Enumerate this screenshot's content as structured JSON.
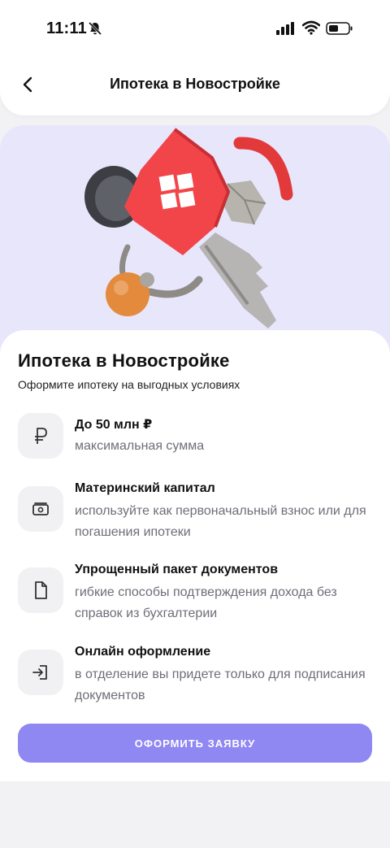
{
  "status_bar": {
    "time": "11:11"
  },
  "nav": {
    "title": "Ипотека в Новостройке"
  },
  "card": {
    "title": "Ипотека в Новостройке",
    "subtitle": "Оформите ипотеку на выгодных условиях"
  },
  "features": [
    {
      "icon": "ruble-icon",
      "title": "До 50 млн ₽",
      "desc": "максимальная сумма"
    },
    {
      "icon": "cash-icon",
      "title": "Материнский капитал",
      "desc": "используйте как первоначальный взнос или для погашения ипотеки"
    },
    {
      "icon": "document-icon",
      "title": "Упрощенный пакет документов",
      "desc": "гибкие способы подтверждения дохода без справок из бухгалтерии"
    },
    {
      "icon": "sign-in-icon",
      "title": "Онлайн оформление",
      "desc": "в отделение вы придете только для подписания документов"
    }
  ],
  "cta": {
    "label": "ОФОРМИТЬ ЗАЯВКУ"
  },
  "colors": {
    "accent": "#8f87f2",
    "hero_bg": "#e8e6fb",
    "house": "#f1454a"
  }
}
